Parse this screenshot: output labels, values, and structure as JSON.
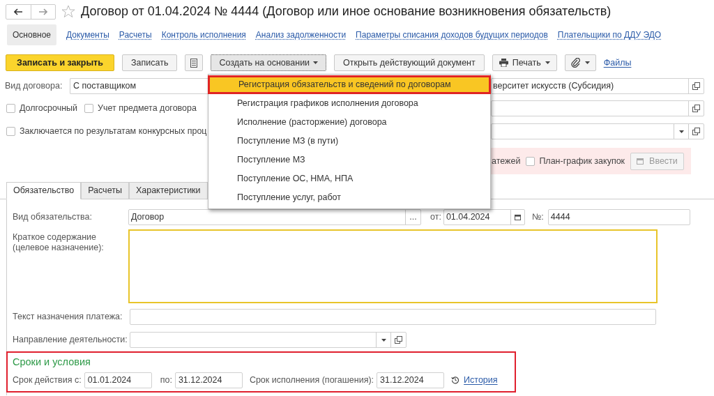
{
  "window": {
    "title": "Договор от 01.04.2024 № 4444 (Договор или иное основание возникновения обязательств)"
  },
  "sections": [
    {
      "label": "Основное",
      "selected": true
    },
    {
      "label": "Документы",
      "selected": false
    },
    {
      "label": "Расчеты",
      "selected": false
    },
    {
      "label": "Контроль исполнения",
      "selected": false
    },
    {
      "label": "Анализ задолженности",
      "selected": false
    },
    {
      "label": "Параметры списания доходов будущих периодов",
      "selected": false
    },
    {
      "label": "Плательщики по ДДУ ЭДО",
      "selected": false
    }
  ],
  "toolbar": [
    {
      "kind": "primary",
      "label": "Записать и закрыть"
    },
    {
      "kind": "button",
      "label": "Записать"
    },
    {
      "kind": "list-icon"
    },
    {
      "kind": "menu",
      "label": "Создать на основании",
      "expanded": true
    },
    {
      "kind": "button",
      "label": "Открыть действующий документ"
    },
    {
      "kind": "print-menu",
      "label": "Печать",
      "expanded": false
    },
    {
      "kind": "clip-menu",
      "expanded": false
    },
    {
      "kind": "link",
      "label": "Файлы"
    }
  ],
  "contract_type": {
    "label": "Вид договора:",
    "value": "С поставщиком"
  },
  "organization": {
    "value": "верситет искусств (Субсидия)"
  },
  "options": [
    {
      "label": "Долгосрочный",
      "checked": false
    },
    {
      "label": "Учет предмета договора",
      "checked": false
    },
    {
      "label": "Заключается по результатам конкурсных проц",
      "checked": false
    }
  ],
  "schedule": {
    "partial_label": "атежей",
    "plan_label": "План-график закупок",
    "plan_checked": false,
    "enter_button": "Ввести",
    "enter_disabled": true
  },
  "tabs": [
    {
      "label": "Обязательство",
      "selected": true
    },
    {
      "label": "Расчеты",
      "selected": false
    },
    {
      "label": "Характеристики",
      "selected": false
    }
  ],
  "obligation": {
    "type_label": "Вид обязательства:",
    "type_value": "Договор",
    "choose_button": "...",
    "date_label": "от:",
    "date": "01.04.2024",
    "number_label": "№:",
    "number": "4444",
    "summary_label": "Краткое содержание (целевое назначение):",
    "payment_text_label": "Текст назначения платежа:",
    "activity_label": "Направление деятельности:"
  },
  "terms": {
    "title": "Сроки и условия",
    "start_label": "Срок действия с:",
    "start": "01.01.2024",
    "end_label": "по:",
    "end": "31.12.2024",
    "due_label": "Срок исполнения (погашения):",
    "due": "31.12.2024",
    "history": "История"
  },
  "dropdown": {
    "items": [
      {
        "label": "Регистрация обязательств и сведений по договорам",
        "selected": true
      },
      {
        "label": "Регистрация графиков исполнения договора",
        "selected": false
      },
      {
        "label": "Исполнение (расторжение) договора",
        "selected": false
      },
      {
        "label": "Поступление МЗ (в пути)",
        "selected": false
      },
      {
        "label": "Поступление МЗ",
        "selected": false
      },
      {
        "label": "Поступление ОС, НМА, НПА",
        "selected": false
      },
      {
        "label": "Поступление услуг, работ",
        "selected": false
      }
    ]
  }
}
